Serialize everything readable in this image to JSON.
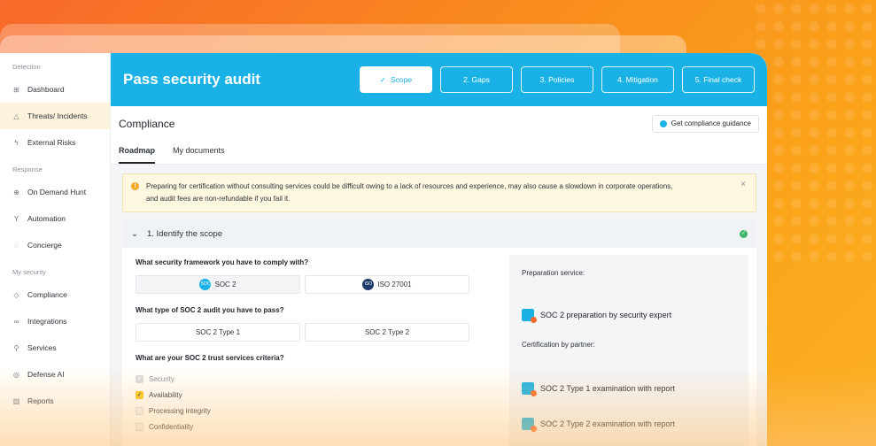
{
  "sidebar": {
    "sections": [
      {
        "title": "Detection",
        "items": [
          {
            "label": "Dashboard",
            "icon": "grid-icon"
          },
          {
            "label": "Threats/ Incidents",
            "icon": "bell-icon",
            "active": true
          },
          {
            "label": "External Risks",
            "icon": "lightning-icon"
          }
        ]
      },
      {
        "title": "Response",
        "items": [
          {
            "label": "On Demand Hunt",
            "icon": "target-icon"
          },
          {
            "label": "Automation",
            "icon": "branch-icon"
          },
          {
            "label": "Concierge",
            "icon": "chat-icon"
          }
        ]
      },
      {
        "title": "My security",
        "items": [
          {
            "label": "Compliance",
            "icon": "shield-icon"
          },
          {
            "label": "Integrations",
            "icon": "link-icon"
          },
          {
            "label": "Services",
            "icon": "wrench-icon"
          },
          {
            "label": "Defense AI",
            "icon": "shield-ai-icon"
          },
          {
            "label": "Reports",
            "icon": "chart-icon"
          }
        ]
      }
    ]
  },
  "banner": {
    "title": "Pass security audit",
    "steps": [
      {
        "label": "Scope",
        "active": true
      },
      {
        "label": "2. Gaps"
      },
      {
        "label": "3. Policies"
      },
      {
        "label": "4. Mitigation"
      },
      {
        "label": "5. Final check"
      }
    ]
  },
  "compliance": {
    "title": "Compliance",
    "guidance_button": "Get compliance guidance",
    "tabs": [
      "Roadmap",
      "My documents"
    ]
  },
  "alert": {
    "line1": "Preparing for certification without consulting services could be difficult owing to a lack of resources and experience, may also cause a slowdown in corporate operations,",
    "line2": "and audit fees are non-refundable if you fail it."
  },
  "scope": {
    "title": "1. Identify the scope",
    "q1": "What security framework you have to comply with?",
    "q1_options": [
      "SOC 2",
      "ISO 27001"
    ],
    "q1_badges": [
      "SOC",
      "ISO"
    ],
    "q2": "What type of SOC 2 audit you have to pass?",
    "q2_options": [
      "SOC 2 Type 1",
      "SOC 2 Type 2"
    ],
    "q3": "What are your SOC 2 trust services criteria?",
    "criteria": [
      {
        "label": "Security",
        "state": "grey"
      },
      {
        "label": "Availability",
        "state": "yellow"
      },
      {
        "label": "Processing integrity",
        "state": "off"
      },
      {
        "label": "Confidentiality",
        "state": "off"
      }
    ]
  },
  "services": {
    "preparation_label": "Preparation service:",
    "preparation_item": "SOC 2 preparation by security expert",
    "certification_label": "Certification by partner:",
    "cert_items": [
      "SOC 2 Type 1 examination with report",
      "SOC 2 Type 2 examination with report"
    ]
  },
  "colors": {
    "accent": "#1ab2e6",
    "brand_orange": "#f7692a",
    "highlight": "#fdf3dc"
  }
}
